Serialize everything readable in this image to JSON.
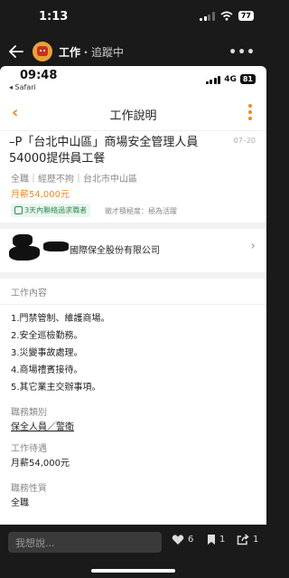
{
  "status_bar": {
    "time": "1:13",
    "battery": "77"
  },
  "app_header": {
    "title": "工作",
    "subtitle": "・追蹤中",
    "more": "•••"
  },
  "inner_status": {
    "time": "09:48",
    "back_app": "◂ Safari",
    "network": "4G",
    "battery": "81"
  },
  "page": {
    "title": "工作說明"
  },
  "job": {
    "title": "–P「台北中山區」商場安全管理人員54000提供員工餐",
    "date": "07–20",
    "meta": "全職｜經歷不拘｜台北市中山區",
    "salary": "月薪54,000元",
    "badge": "3天內聯絡過求職者",
    "efficiency": "徵才積極度：極為活躍"
  },
  "company": {
    "name": "國際保全股份有限公司"
  },
  "content": {
    "section_title": "工作內容",
    "lines": [
      "1.門禁管制、維護商場。",
      "2.安全巡檢勤務。",
      "3.災變事故處理。",
      "4.商場禮賓接待。",
      "5.其它業主交辦事項。"
    ]
  },
  "fields": [
    {
      "label": "職務類別",
      "value": "保全人員／警衛"
    },
    {
      "label": "工作待遇",
      "value": "月薪54,000元"
    },
    {
      "label": "職務性質",
      "value": "全職"
    }
  ],
  "bottom_bar": {
    "input_placeholder": "我想說...",
    "like_count": "6",
    "bookmark_count": "1",
    "share_count": "1"
  },
  "colors": {
    "accent": "#f08a24",
    "green": "#2e8b57",
    "dark_bg": "#1a1a1a"
  },
  "icons": [
    "back-arrow-icon",
    "avatar-icon",
    "more-icon",
    "chevron-left-icon",
    "vertical-dots-icon",
    "chat-icon",
    "chevron-right-icon",
    "heart-icon",
    "bookmark-icon",
    "share-icon"
  ]
}
